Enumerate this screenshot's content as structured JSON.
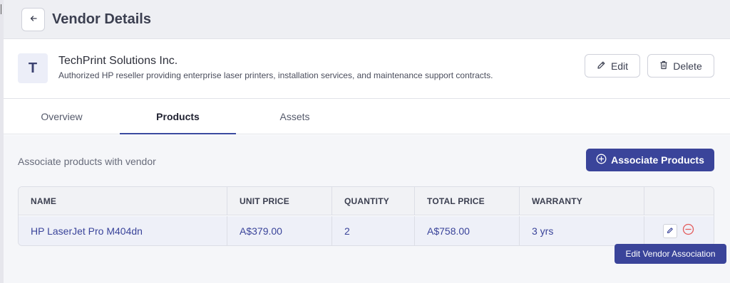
{
  "header": {
    "title": "Vendor Details",
    "back_icon": "arrow-left-icon"
  },
  "vendor": {
    "avatar_letter": "T",
    "name": "TechPrint Solutions Inc.",
    "description": "Authorized HP reseller providing enterprise laser printers, installation services, and maintenance support contracts.",
    "edit_label": "Edit",
    "delete_label": "Delete"
  },
  "tabs": [
    {
      "label": "Overview",
      "active": false
    },
    {
      "label": "Products",
      "active": true
    },
    {
      "label": "Assets",
      "active": false
    }
  ],
  "products": {
    "section_label": "Associate products with vendor",
    "associate_button_label": "Associate Products",
    "columns": [
      "NAME",
      "UNIT PRICE",
      "QUANTITY",
      "TOTAL PRICE",
      "WARRANTY"
    ],
    "rows": [
      {
        "name": "HP LaserJet Pro M404dn",
        "unit_price": "A$379.00",
        "quantity": "2",
        "total_price": "A$758.00",
        "warranty": "3 yrs"
      }
    ],
    "tooltip": "Edit Vendor Association"
  },
  "colors": {
    "accent": "#3a449a",
    "remove": "#e35b5b"
  }
}
